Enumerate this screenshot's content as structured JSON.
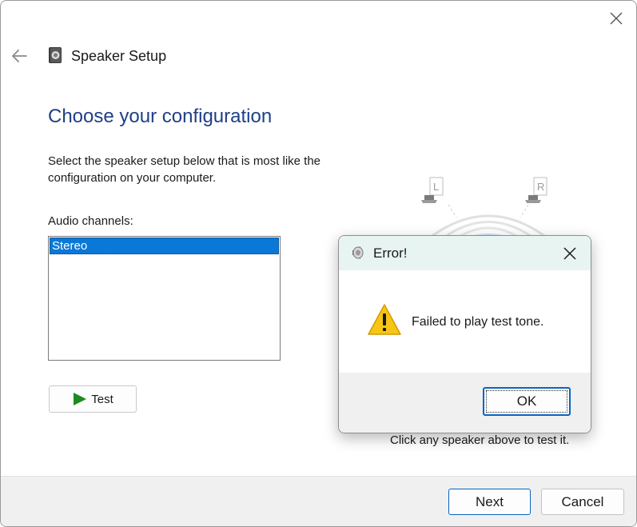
{
  "window": {
    "title": "Speaker Setup",
    "close_icon": "close-icon",
    "back_icon": "back-arrow-icon",
    "app_icon": "speaker-icon"
  },
  "main": {
    "heading": "Choose your configuration",
    "description": "Select the speaker setup below that is most like the configuration on your computer.",
    "channels_label": "Audio channels:",
    "channels": [
      "Stereo"
    ],
    "selected_channel": "Stereo",
    "test_button": "Test",
    "speaker_left_label": "L",
    "speaker_right_label": "R",
    "hint": "Click any speaker above to test it."
  },
  "footer": {
    "next": "Next",
    "cancel": "Cancel"
  },
  "dialog": {
    "title": "Error!",
    "message": "Failed to play test tone.",
    "ok": "OK",
    "icon": "warning-icon"
  },
  "colors": {
    "heading": "#1e3f87",
    "selection": "#0a78d7",
    "primary_border": "#0a64c0",
    "dialog_title_bg": "#e8f4f2",
    "footer_bg": "#f0f0f0"
  }
}
